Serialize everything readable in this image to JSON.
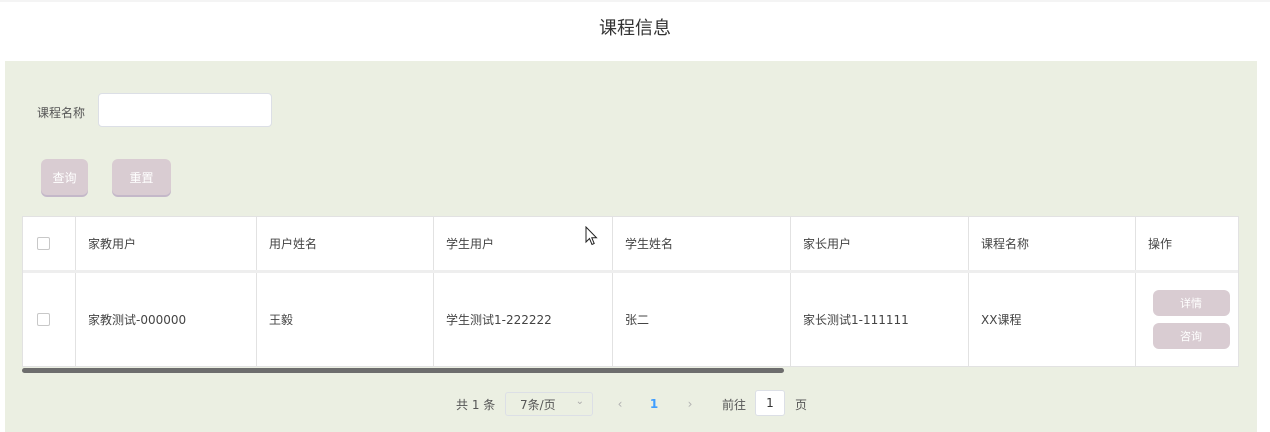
{
  "page": {
    "title": "课程信息"
  },
  "search": {
    "label": "课程名称",
    "value": "",
    "placeholder": "",
    "query_label": "查询",
    "reset_label": "重置"
  },
  "table": {
    "headers": [
      "家教用户",
      "用户姓名",
      "学生用户",
      "学生姓名",
      "家长用户",
      "课程名称",
      "操作"
    ],
    "rows": [
      {
        "tutor_user": "家教测试-000000",
        "user_name": "王毅",
        "student_user": "学生测试1-222222",
        "student_name": "张二",
        "parent_user": "家长测试1-111111",
        "course_name": "XX课程",
        "detail_label": "详情",
        "consult_label": "咨询"
      }
    ]
  },
  "pagination": {
    "total_text": "共 1 条",
    "page_size": "7条/页",
    "current_page": "1",
    "prev_icon": "‹",
    "next_icon": "›",
    "goto_label": "前往",
    "goto_value": "1",
    "page_suffix": "页"
  },
  "colors": {
    "panel_bg": "#ebefe2",
    "button_bg": "#d9ccd2",
    "active_page": "#409eff"
  }
}
